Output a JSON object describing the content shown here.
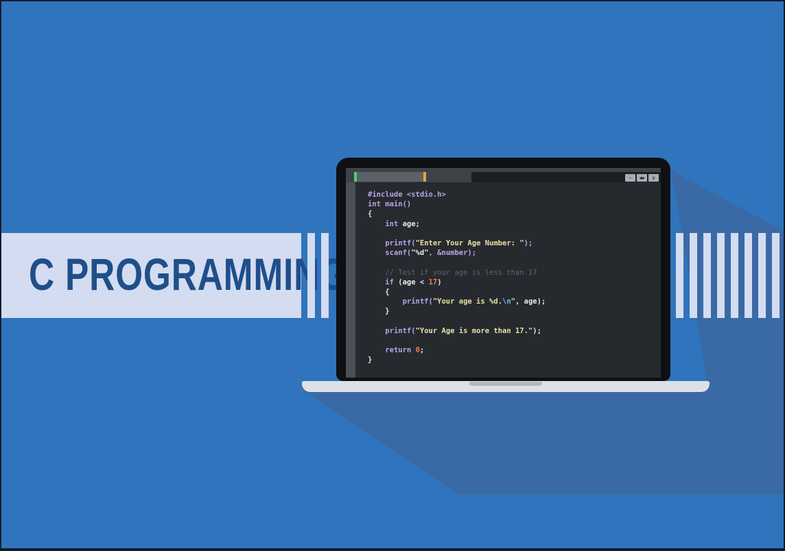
{
  "banner": {
    "title": "C PROGRAMMING"
  },
  "window": {
    "minimize_label": "–",
    "maximize_label": "▬",
    "close_label": "x"
  },
  "code": [
    [
      {
        "t": "#include <stdio.h>",
        "c": "kw"
      }
    ],
    [
      {
        "t": "int main()",
        "c": "kw"
      }
    ],
    [
      {
        "t": "{",
        "c": "id"
      }
    ],
    [
      {
        "t": "    ",
        "c": "id"
      },
      {
        "t": "int",
        "c": "kw"
      },
      {
        "t": " age;",
        "c": "id"
      }
    ],
    [],
    [
      {
        "t": "    ",
        "c": "id"
      },
      {
        "t": "printf(",
        "c": "kw"
      },
      {
        "t": "\"Enter Your Age Number: \"",
        "c": "str"
      },
      {
        "t": ");",
        "c": "kw"
      }
    ],
    [
      {
        "t": "    ",
        "c": "id"
      },
      {
        "t": "scanf(",
        "c": "kw"
      },
      {
        "t": "\"%d\"",
        "c": "id"
      },
      {
        "t": ", &number);",
        "c": "kw"
      }
    ],
    [],
    [
      {
        "t": "    // Test if your age is less than 17",
        "c": "cm"
      }
    ],
    [
      {
        "t": "    ",
        "c": "id"
      },
      {
        "t": "if",
        "c": "kw"
      },
      {
        "t": " (age < ",
        "c": "id"
      },
      {
        "t": "17",
        "c": "num"
      },
      {
        "t": ")",
        "c": "id"
      }
    ],
    [
      {
        "t": "    {",
        "c": "id"
      }
    ],
    [
      {
        "t": "        ",
        "c": "id"
      },
      {
        "t": "printf(",
        "c": "kw"
      },
      {
        "t": "\"Your age is %d.",
        "c": "str"
      },
      {
        "t": "\\n",
        "c": "esc"
      },
      {
        "t": "\"",
        "c": "str"
      },
      {
        "t": ", age);",
        "c": "id"
      }
    ],
    [
      {
        "t": "    }",
        "c": "id"
      }
    ],
    [],
    [
      {
        "t": "    ",
        "c": "id"
      },
      {
        "t": "printf(",
        "c": "kw"
      },
      {
        "t": "\"Your Age is more than 17.\"",
        "c": "str"
      },
      {
        "t": ");",
        "c": "id"
      }
    ],
    [],
    [
      {
        "t": "    ",
        "c": "id"
      },
      {
        "t": "return",
        "c": "kw"
      },
      {
        "t": " ",
        "c": "id"
      },
      {
        "t": "0",
        "c": "num"
      },
      {
        "t": ";",
        "c": "id"
      }
    ],
    [
      {
        "t": "}",
        "c": "id"
      }
    ]
  ]
}
